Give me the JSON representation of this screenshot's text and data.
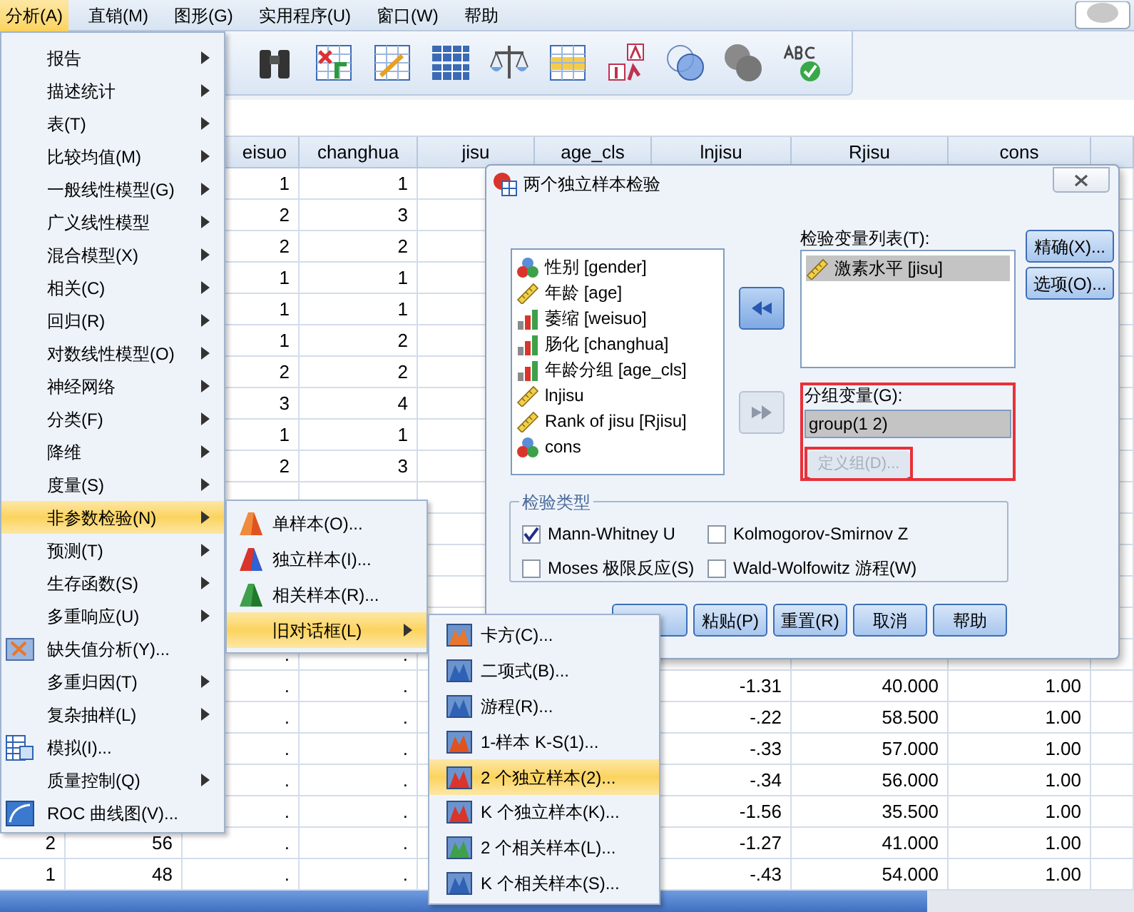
{
  "menubar": [
    {
      "label": "分析(A)",
      "selected": true
    },
    {
      "label": "直销(M)",
      "selected": false
    },
    {
      "label": "图形(G)",
      "selected": false
    },
    {
      "label": "实用程序(U)",
      "selected": false
    },
    {
      "label": "窗口(W)",
      "selected": false
    },
    {
      "label": "帮助",
      "selected": false
    }
  ],
  "table": {
    "columns": [
      null,
      null,
      "eisuo",
      "changhua",
      "jisu",
      "age_cls",
      "lnjisu",
      "Rjisu",
      "cons",
      null
    ],
    "rows": [
      [
        null,
        null,
        "1",
        "1",
        null,
        null,
        null,
        null,
        null,
        null
      ],
      [
        null,
        null,
        "2",
        "3",
        null,
        null,
        null,
        null,
        null,
        null
      ],
      [
        null,
        null,
        "2",
        "2",
        null,
        null,
        null,
        null,
        null,
        null
      ],
      [
        null,
        null,
        "1",
        "1",
        null,
        null,
        null,
        null,
        null,
        null
      ],
      [
        null,
        null,
        "1",
        "1",
        null,
        null,
        null,
        null,
        null,
        null
      ],
      [
        null,
        null,
        "1",
        "2",
        null,
        null,
        null,
        null,
        null,
        null
      ],
      [
        null,
        null,
        "2",
        "2",
        null,
        null,
        null,
        null,
        null,
        null
      ],
      [
        null,
        null,
        "3",
        "4",
        null,
        null,
        null,
        null,
        null,
        null
      ],
      [
        null,
        null,
        "1",
        "1",
        null,
        null,
        null,
        null,
        null,
        null
      ],
      [
        null,
        null,
        "2",
        "3",
        null,
        null,
        null,
        null,
        null,
        null
      ],
      [
        null,
        null,
        null,
        null,
        null,
        null,
        null,
        null,
        null,
        null
      ],
      [
        null,
        null,
        null,
        null,
        null,
        null,
        null,
        null,
        null,
        null
      ],
      [
        null,
        null,
        null,
        null,
        null,
        null,
        null,
        null,
        null,
        null
      ],
      [
        null,
        null,
        null,
        null,
        null,
        null,
        null,
        null,
        null,
        null
      ],
      [
        null,
        null,
        null,
        null,
        null,
        null,
        null,
        null,
        null,
        null
      ],
      [
        null,
        null,
        ".",
        ".",
        null,
        null,
        null,
        null,
        null,
        null
      ],
      [
        null,
        null,
        ".",
        ".",
        null,
        null,
        "-1.31",
        "40.000",
        "1.00",
        null
      ],
      [
        null,
        null,
        ".",
        ".",
        null,
        null,
        "-.22",
        "58.500",
        "1.00",
        null
      ],
      [
        null,
        null,
        ".",
        ".",
        null,
        null,
        "-.33",
        "57.000",
        "1.00",
        null
      ],
      [
        null,
        null,
        ".",
        ".",
        null,
        null,
        "-.34",
        "56.000",
        "1.00",
        null
      ],
      [
        null,
        null,
        ".",
        ".",
        null,
        null,
        "-1.56",
        "35.500",
        "1.00",
        null
      ],
      [
        "2",
        "56",
        ".",
        ".",
        null,
        null,
        "-1.27",
        "41.000",
        "1.00",
        null
      ],
      [
        "1",
        "48",
        ".",
        ".",
        null,
        null,
        "-.43",
        "54.000",
        "1.00",
        null
      ]
    ]
  },
  "analyze_menu": [
    {
      "label": "报告",
      "kind": "submenu",
      "selected": false
    },
    {
      "label": "描述统计",
      "kind": "submenu",
      "selected": false
    },
    {
      "label": "表(T)",
      "kind": "submenu",
      "selected": false
    },
    {
      "label": "比较均值(M)",
      "kind": "submenu",
      "selected": false
    },
    {
      "label": "一般线性模型(G)",
      "kind": "submenu",
      "selected": false
    },
    {
      "label": "广义线性模型",
      "kind": "submenu",
      "selected": false
    },
    {
      "label": "混合模型(X)",
      "kind": "submenu",
      "selected": false
    },
    {
      "label": "相关(C)",
      "kind": "submenu",
      "selected": false
    },
    {
      "label": "回归(R)",
      "kind": "submenu",
      "selected": false
    },
    {
      "label": "对数线性模型(O)",
      "kind": "submenu",
      "selected": false
    },
    {
      "label": "神经网络",
      "kind": "submenu",
      "selected": false
    },
    {
      "label": "分类(F)",
      "kind": "submenu",
      "selected": false
    },
    {
      "label": "降维",
      "kind": "submenu",
      "selected": false
    },
    {
      "label": "度量(S)",
      "kind": "submenu",
      "selected": false
    },
    {
      "label": "非参数检验(N)",
      "kind": "submenu",
      "selected": true
    },
    {
      "label": "预测(T)",
      "kind": "submenu",
      "selected": false
    },
    {
      "label": "生存函数(S)",
      "kind": "submenu",
      "selected": false
    },
    {
      "label": "多重响应(U)",
      "kind": "submenu",
      "selected": false
    },
    {
      "label": "缺失值分析(Y)...",
      "kind": "command",
      "selected": false
    },
    {
      "label": "多重归因(T)",
      "kind": "submenu",
      "selected": false
    },
    {
      "label": "复杂抽样(L)",
      "kind": "submenu",
      "selected": false
    },
    {
      "label": "模拟(I)...",
      "kind": "command",
      "selected": false
    },
    {
      "label": "质量控制(Q)",
      "kind": "submenu",
      "selected": false
    },
    {
      "label": "ROC 曲线图(V)...",
      "kind": "command",
      "selected": false
    }
  ],
  "nonparametric_menu": [
    {
      "label": "单样本(O)...",
      "kind": "command",
      "selected": false
    },
    {
      "label": "独立样本(I)...",
      "kind": "command",
      "selected": false
    },
    {
      "label": "相关样本(R)...",
      "kind": "command",
      "selected": false
    },
    {
      "label": "旧对话框(L)",
      "kind": "submenu",
      "selected": true
    }
  ],
  "legacy_menu": [
    {
      "label": "卡方(C)...",
      "selected": false
    },
    {
      "label": "二项式(B)...",
      "selected": false
    },
    {
      "label": "游程(R)...",
      "selected": false
    },
    {
      "label": "1-样本 K-S(1)...",
      "selected": false
    },
    {
      "label": "2 个独立样本(2)...",
      "selected": true
    },
    {
      "label": "K 个独立样本(K)...",
      "selected": false
    },
    {
      "label": "2 个相关样本(L)...",
      "selected": false
    },
    {
      "label": "K 个相关样本(S)...",
      "selected": false
    }
  ],
  "dialog": {
    "title": "两个独立样本检验",
    "variables": [
      {
        "label": "性别 [gender]",
        "kind": "nominal"
      },
      {
        "label": "年龄 [age]",
        "kind": "scale"
      },
      {
        "label": "萎缩 [weisuo]",
        "kind": "ordinal"
      },
      {
        "label": "肠化 [changhua]",
        "kind": "ordinal"
      },
      {
        "label": "年龄分组 [age_cls]",
        "kind": "ordinal"
      },
      {
        "label": "lnjisu",
        "kind": "scale"
      },
      {
        "label": "Rank of jisu [Rjisu]",
        "kind": "scale"
      },
      {
        "label": "cons",
        "kind": "nominal"
      }
    ],
    "move_buttons": [
      {
        "disabled": false
      },
      {
        "disabled": true
      }
    ],
    "test_variables": {
      "label": "检验变量列表(T):",
      "items": [
        {
          "label": "激素水平 [jisu]",
          "kind": "scale",
          "selected": true
        }
      ]
    },
    "side_buttons": [
      "精确(X)...",
      "选项(O)..."
    ],
    "grouping": {
      "label": "分组变量(G):",
      "value": "group(1 2)",
      "highlighted": true,
      "define_button": {
        "label": "定义组(D)...",
        "disabled": true,
        "highlighted": true
      }
    },
    "test_type": {
      "legend": "检验类型",
      "options": [
        {
          "label": "Mann-Whitney U",
          "checked": true
        },
        {
          "label": "Kolmogorov-Smirnov Z",
          "checked": false
        },
        {
          "label": "Moses 极限反应(S)",
          "checked": false
        },
        {
          "label": "Wald-Wolfowitz 游程(W)",
          "checked": false
        }
      ]
    },
    "buttons": [
      "粘贴(P)",
      "重置(R)",
      "取消",
      "帮助"
    ]
  }
}
